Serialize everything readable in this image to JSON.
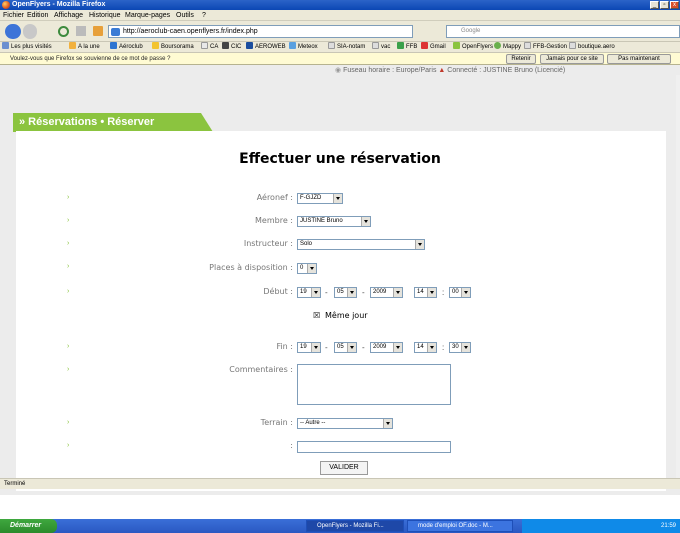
{
  "window": {
    "title": "OpenFlyers - Mozilla Firefox"
  },
  "menu": [
    "Fichier",
    "Edition",
    "Affichage",
    "Historique",
    "Marque-pages",
    "Outils",
    "?"
  ],
  "nav": {
    "url": "http://aeroclub-caen.openflyers.fr/index.php",
    "search_placeholder": "Google"
  },
  "bookmarks": [
    "Les plus visités",
    "A la une",
    "Aéroclub",
    "Boursorama",
    "CA",
    "CIC",
    "AEROWEB",
    "Meteox",
    "SIA-notam",
    "vac",
    "FFB",
    "Gmail",
    "OpenFlyers",
    "Mappy",
    "FFB-Gestion",
    "boutique.aero"
  ],
  "password_bar": {
    "message": "Voulez-vous que Firefox se souvienne de ce mot de passe ?",
    "buttons": [
      "Retenir",
      "Jamais pour ce site",
      "Pas maintenant"
    ]
  },
  "header": {
    "timezone": "Fuseau horaire : Europe/Paris",
    "connected": "Connecté : JUSTINE Bruno  (Licencié)"
  },
  "banner": {
    "text": "» Réservations • Réserver"
  },
  "form": {
    "title": "Effectuer une réservation",
    "aeronef_label": "Aéronef :",
    "aeronef_value": "F-GJZD",
    "membre_label": "Membre :",
    "membre_value": "JUSTINE Bruno",
    "instructeur_label": "Instructeur :",
    "instructeur_value": "Solo",
    "places_label": "Places à disposition :",
    "places_value": "0",
    "debut_label": "Début :",
    "debut": {
      "day": "19",
      "month": "05",
      "year": "2009",
      "hour": "14",
      "minute": "00"
    },
    "meme_jour_label": "Même jour",
    "fin_label": "Fin :",
    "fin": {
      "day": "19",
      "month": "05",
      "year": "2009",
      "hour": "14",
      "minute": "30"
    },
    "commentaires_label": "Commentaires :",
    "terrain_label": "Terrain :",
    "terrain_value": "-- Autre --",
    "extra_label": ":",
    "submit_label": "VALIDER"
  },
  "status": {
    "text": "Terminé"
  },
  "taskbar": {
    "start": "Démarrer",
    "tasks": [
      "OpenFlyers - Mozilla Fi...",
      "mode d'emploi OF.doc - M..."
    ],
    "clock": "21:59"
  }
}
